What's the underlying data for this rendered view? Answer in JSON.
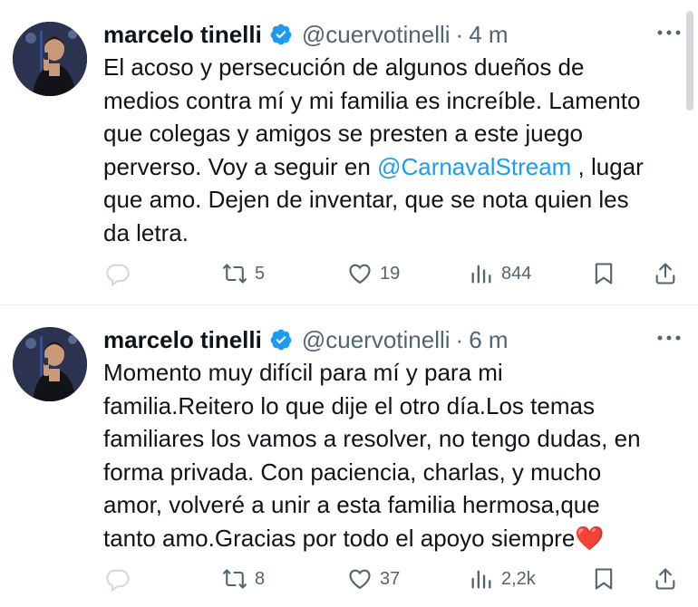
{
  "tweets": [
    {
      "author": {
        "name": "marcelo tinelli",
        "handle": "@cuervotinelli",
        "time": "4 m",
        "separator": "·"
      },
      "text": {
        "line1": "El acoso y persecución de algunos dueños de",
        "line2": "medios contra mí y mi familia es increíble. Lamento",
        "line3": "que colegas y amigos se presten a este juego",
        "line4_pre": "perverso. Voy a seguir en ",
        "line4_mention": "@CarnavalStream",
        "line4_post": " , lugar",
        "line5": "que amo. Dejen de inventar, que se nota quien les",
        "line6": "da letra."
      },
      "stats": {
        "retweets": "5",
        "likes": "19",
        "views": "844"
      }
    },
    {
      "author": {
        "name": "marcelo tinelli",
        "handle": "@cuervotinelli",
        "time": "6 m",
        "separator": "·"
      },
      "text": {
        "line1": "Momento muy difícil para mí y para mi",
        "line2": "familia.Reitero lo que dije el otro día.Los temas",
        "line3": "familiares los vamos a resolver, no tengo dudas, en",
        "line4": "forma privada. Con paciencia, charlas, y mucho",
        "line5": "amor, volveré a unir a esta familia hermosa,que",
        "line6": "tanto amo.Gracias por todo el apoyo siempre",
        "emoji": "❤️"
      },
      "stats": {
        "retweets": "8",
        "likes": "37",
        "views": "2,2k"
      }
    }
  ],
  "colors": {
    "accent": "#1d9bf0",
    "muted": "#536471",
    "text": "#0f1419",
    "heart": "#e0245e"
  },
  "icons": [
    "verified-badge-icon",
    "more-icon",
    "reply-icon",
    "retweet-icon",
    "like-icon",
    "views-icon",
    "bookmark-icon",
    "share-icon"
  ]
}
